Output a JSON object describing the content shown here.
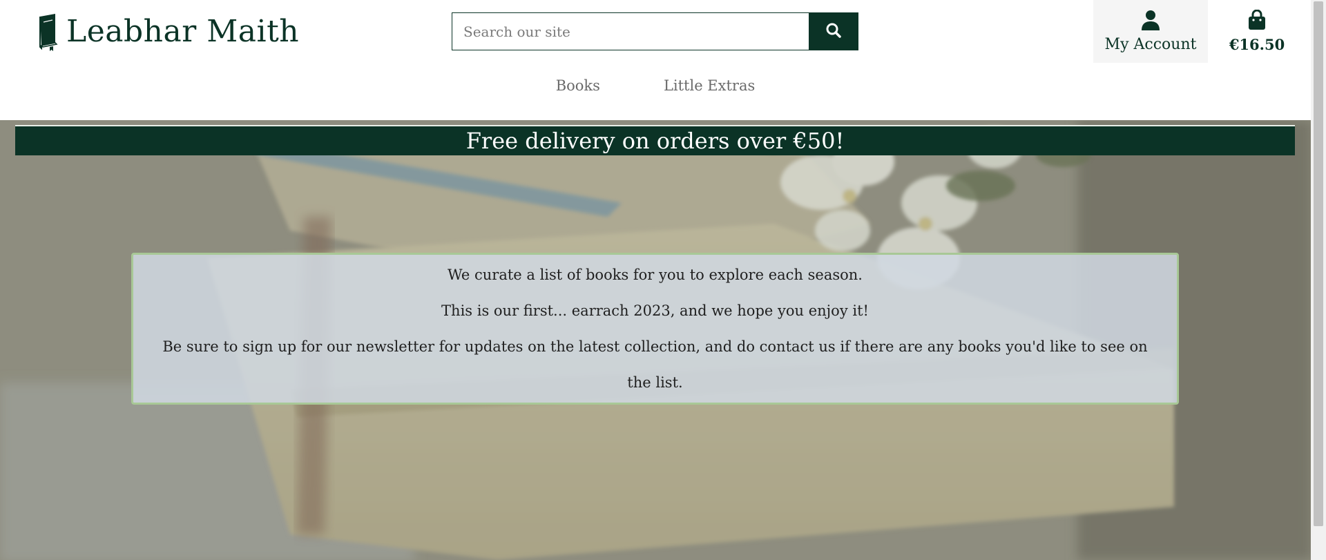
{
  "header": {
    "logo_text": "Leabhar Maith",
    "logo_icon": "book-icon",
    "search": {
      "placeholder": "Search our site",
      "value": "",
      "button_icon": "search-icon"
    },
    "account": {
      "icon": "user-icon",
      "label": "My Account"
    },
    "cart": {
      "icon": "shopping-bag-icon",
      "total": "€16.50"
    }
  },
  "nav": {
    "items": [
      {
        "label": "Books"
      },
      {
        "label": "Little Extras"
      }
    ]
  },
  "promo": {
    "text": "Free delivery on orders over €50!"
  },
  "intro": {
    "paragraphs": [
      "We curate a list of books for you to explore each season.",
      "This is our first... earrach 2023, and we hope you enjoy it!",
      "Be sure to sign up for our newsletter for updates on the latest collection, and do contact us if there are any books you'd like to see on the list."
    ]
  },
  "colors": {
    "brand": "#0b3326",
    "intro_border": "#a8c896",
    "nav_text": "#6a6a6a"
  }
}
